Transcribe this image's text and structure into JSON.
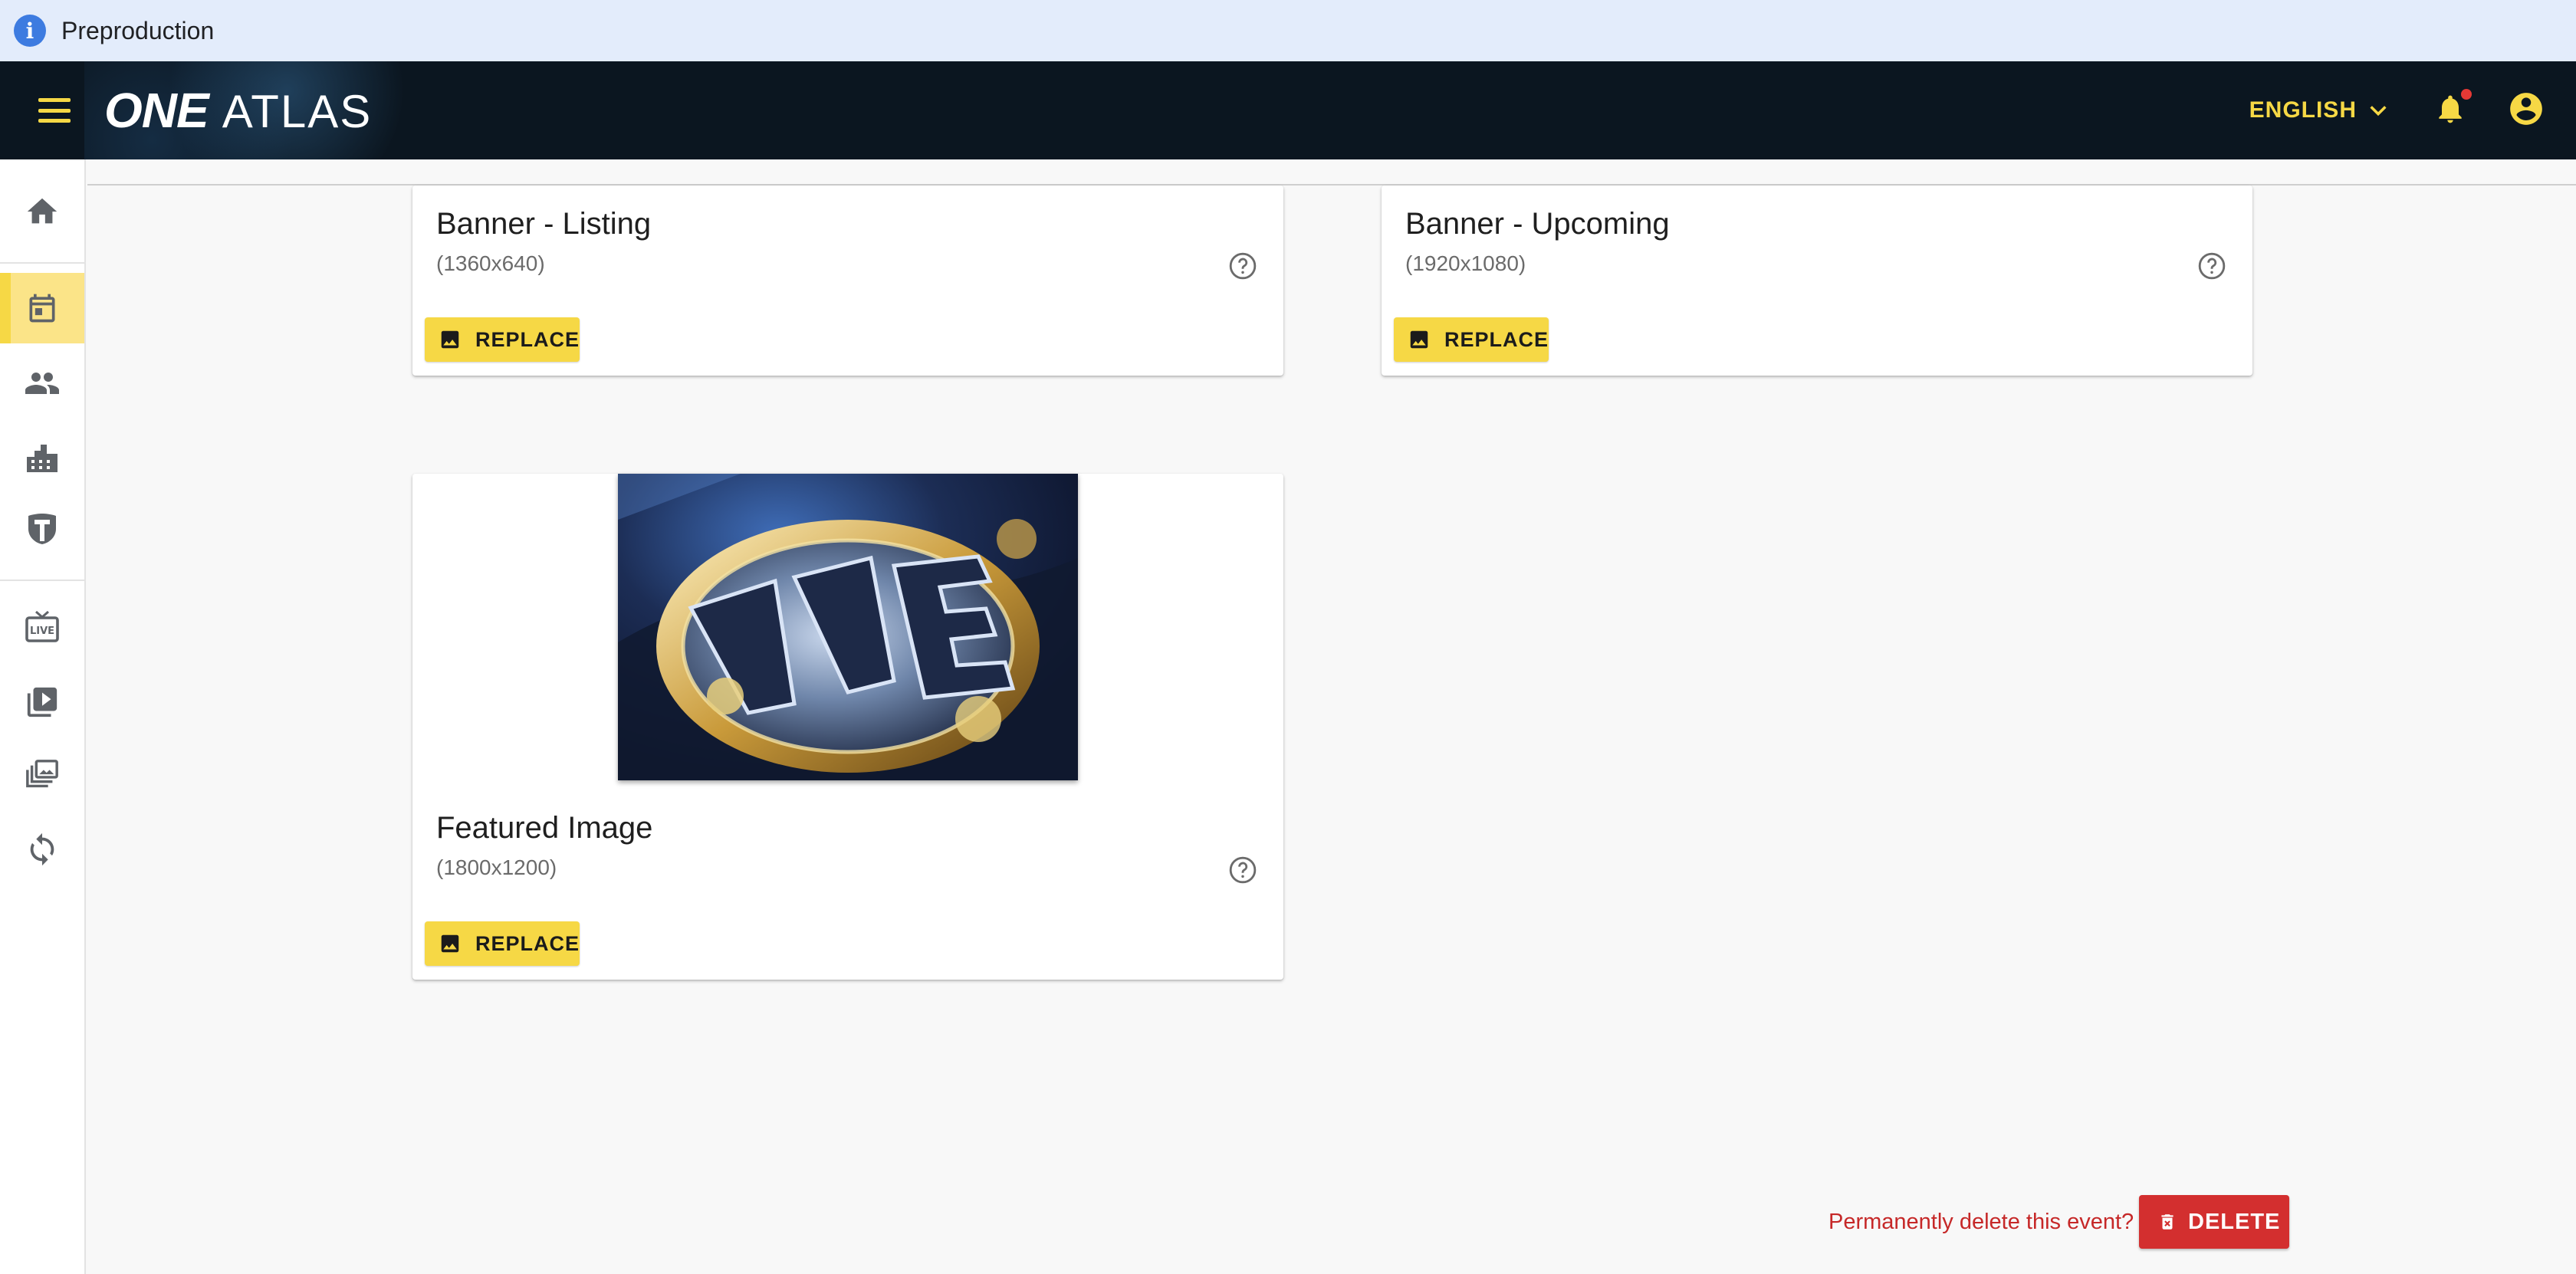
{
  "environment": {
    "label": "Preproduction",
    "icon": "info-icon"
  },
  "header": {
    "logo_primary": "ONE",
    "logo_secondary": "ATLAS",
    "language": "ENGLISH",
    "accent_color": "#f6d845",
    "background_color": "#0b1620"
  },
  "sidebar": {
    "items": [
      {
        "name": "home",
        "icon": "home-icon"
      },
      {
        "name": "events",
        "icon": "calendar-icon",
        "active": true
      },
      {
        "name": "athletes",
        "icon": "people-icon"
      },
      {
        "name": "venues",
        "icon": "buildings-icon"
      },
      {
        "name": "organizations",
        "icon": "shield-icon"
      },
      {
        "name": "live",
        "icon": "live-tv-icon"
      },
      {
        "name": "videos",
        "icon": "video-library-icon"
      },
      {
        "name": "galleries",
        "icon": "gallery-icon"
      },
      {
        "name": "sync",
        "icon": "sync-icon"
      }
    ]
  },
  "cards": {
    "banner_listing": {
      "title": "Banner - Listing",
      "size": "(1360x640)",
      "button": "REPLACE"
    },
    "banner_upcoming": {
      "title": "Banner - Upcoming",
      "size": "(1920x1080)",
      "button": "REPLACE"
    },
    "featured": {
      "title": "Featured Image",
      "size": "(1800x1200)",
      "button": "REPLACE",
      "image": "championship-belt-image"
    }
  },
  "danger": {
    "prompt": "Permanently delete this event?",
    "button": "DELETE",
    "color": "#d32f2f"
  }
}
